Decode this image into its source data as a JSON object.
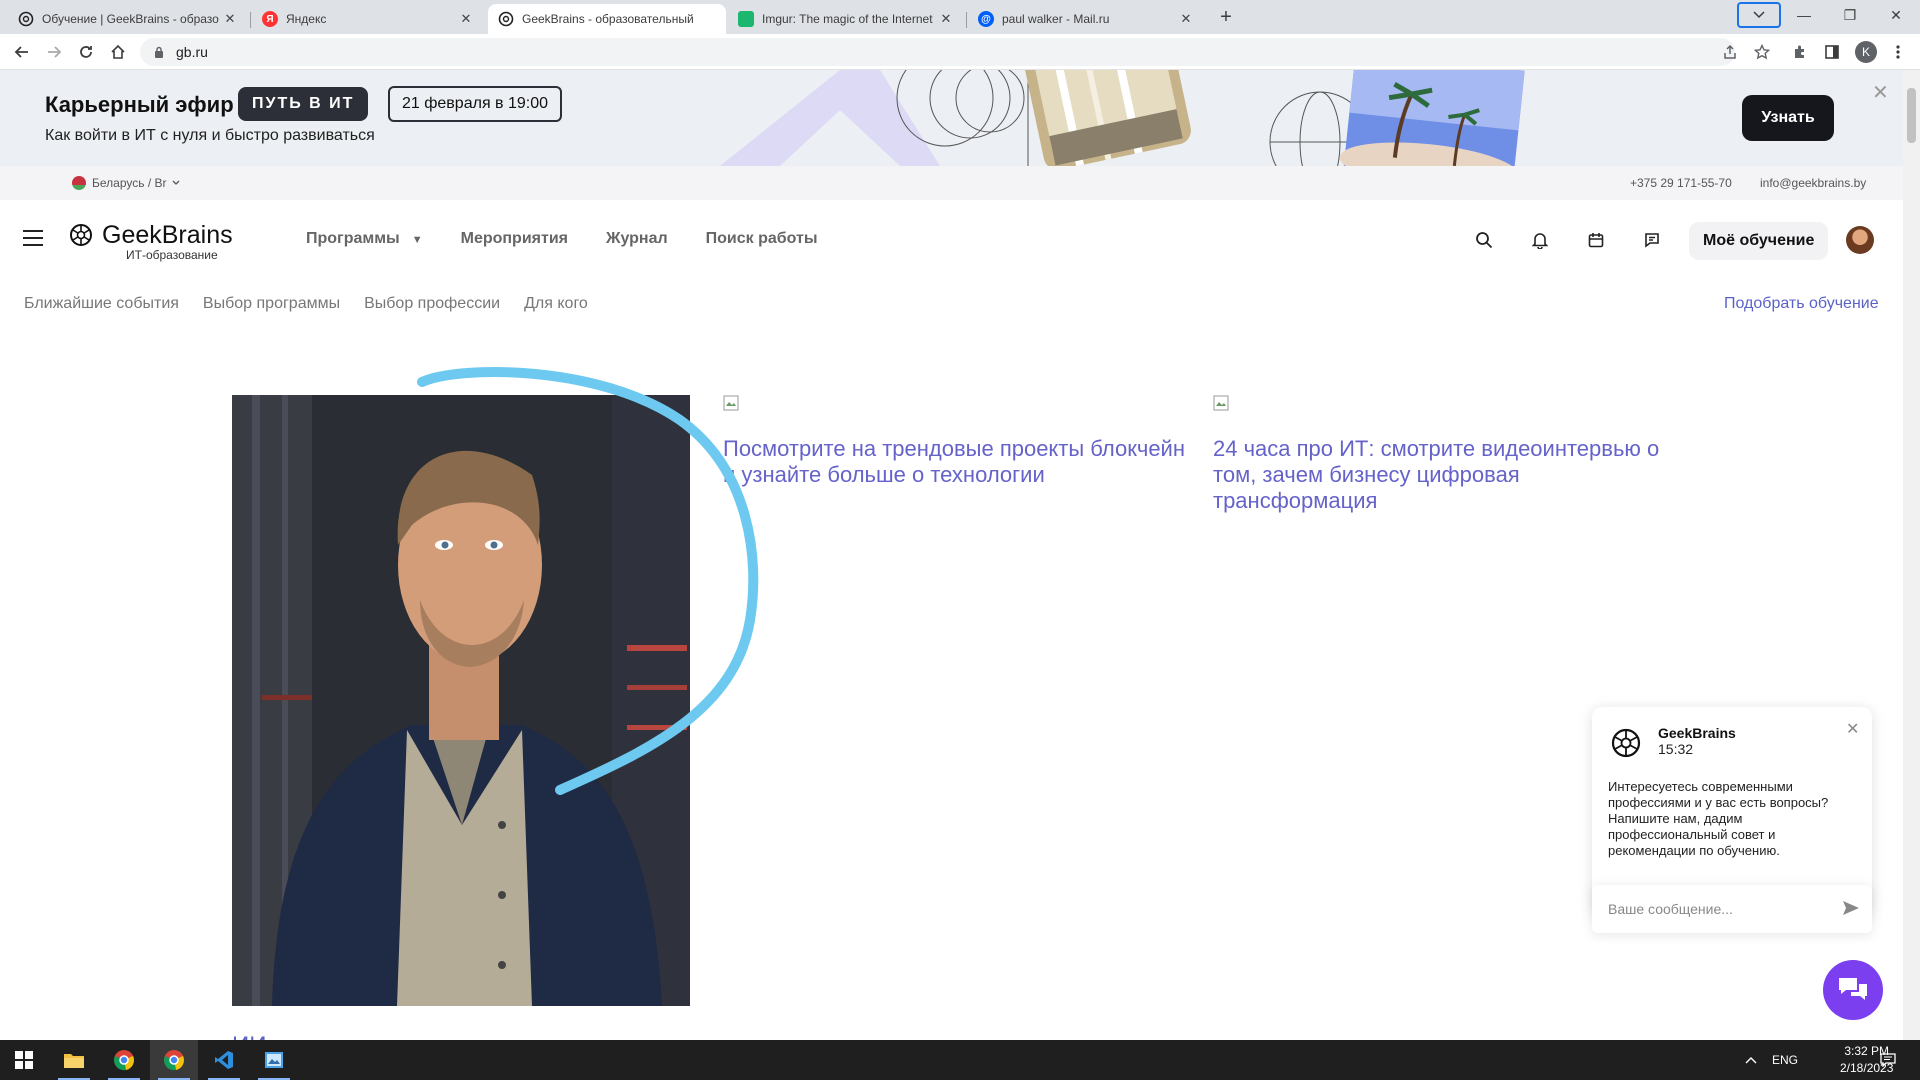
{
  "browser": {
    "tabs": [
      {
        "title": "Обучение | GeekBrains - образо",
        "favicon": "geekbrains-icon"
      },
      {
        "title": "Яндекс",
        "favicon": "yandex-icon",
        "favicon_letter": "Я"
      },
      {
        "title": "GeekBrains - образовательный",
        "favicon": "geekbrains-icon"
      },
      {
        "title": "Imgur: The magic of the Internet",
        "favicon": "imgur-icon"
      },
      {
        "title": "paul walker - Mail.ru",
        "favicon": "mailru-icon",
        "favicon_letter": "@"
      }
    ],
    "active_tab": 2,
    "url": "gb.ru",
    "profile_letter": "K"
  },
  "banner": {
    "title": "Карьерный эфир",
    "pill": "ПУТЬ В ИТ",
    "date": "21 февраля в 19:00",
    "subtitle": "Как войти в ИТ с нуля и быстро развиваться",
    "button": "Узнать",
    "close": "✕"
  },
  "topinfo": {
    "region": "Беларусь / Br",
    "phone": "+375 29 171-55-70",
    "email": "info@geekbrains.by"
  },
  "header": {
    "logo_name": "GeekBrains",
    "logo_sub": "ИТ-образование",
    "nav": [
      "Программы",
      "Мероприятия",
      "Журнал",
      "Поиск работы"
    ],
    "my_learning": "Моё обучение"
  },
  "subnav": {
    "items": [
      "Ближайшие события",
      "Выбор программы",
      "Выбор профессии",
      "Для кого"
    ],
    "pick": "Подобрать обучение"
  },
  "content": {
    "card1": "Посмотрите на трендовые проекты блокчейн и узнайте больше о технологии",
    "card2": "24 часа про ИТ: смотрите видеоинтервью о том, зачем бизнесу цифровая трансформация",
    "bottom_text": "ИИ"
  },
  "chat": {
    "name": "GeekBrains",
    "time": "15:32",
    "message": "Интересуетесь современными профессиями и у вас есть вопросы? Напишите нам, дадим профессиональный совет и рекомендации по обучению.",
    "input_placeholder": "Ваше сообщение...",
    "close": "✕"
  },
  "taskbar": {
    "lang": "ENG",
    "time": "3:32 PM",
    "date": "2/18/2023"
  },
  "colors": {
    "link": "#6563c9",
    "chat_fab": "#7b3ff0",
    "scribble": "#6dc9f0"
  }
}
